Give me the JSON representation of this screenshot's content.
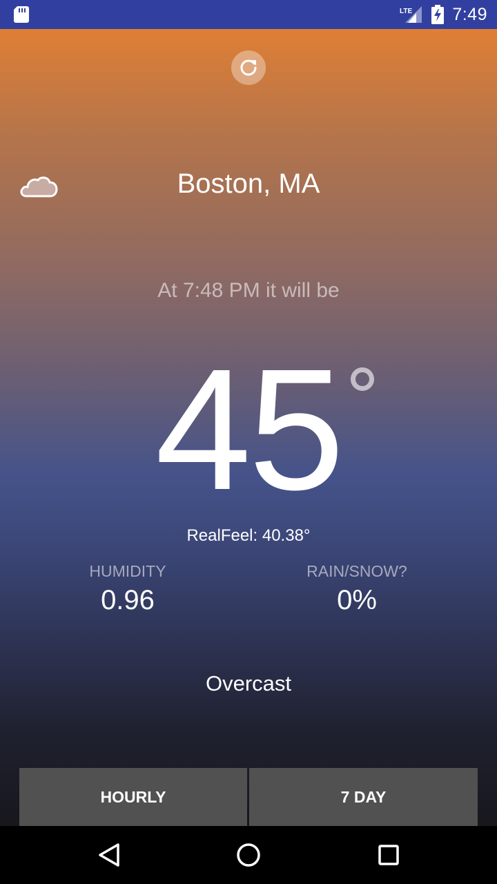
{
  "status_bar": {
    "time": "7:49",
    "network": "LTE",
    "icons": [
      "sd-card-icon",
      "lte-signal-icon",
      "battery-charging-icon"
    ]
  },
  "header": {
    "refresh_icon": "refresh-icon",
    "weather_icon": "cloud-icon",
    "city": "Boston, MA"
  },
  "forecast": {
    "subtitle": "At 7:48 PM it will be",
    "temperature": "45",
    "realfeel": "RealFeel: 40.38°",
    "humidity_label": "HUMIDITY",
    "humidity_value": "0.96",
    "precip_label": "RAIN/SNOW?",
    "precip_value": "0%",
    "condition": "Overcast"
  },
  "buttons": {
    "hourly": "HOURLY",
    "seven_day": "7 DAY"
  },
  "nav": {
    "icons": [
      "back-icon",
      "home-icon",
      "recents-icon"
    ]
  },
  "colors": {
    "status_bar": "#3140a0",
    "gradient_top": "#df7f36",
    "gradient_mid": "#45538a",
    "gradient_bottom": "#17171c",
    "button_bg": "#515151"
  }
}
